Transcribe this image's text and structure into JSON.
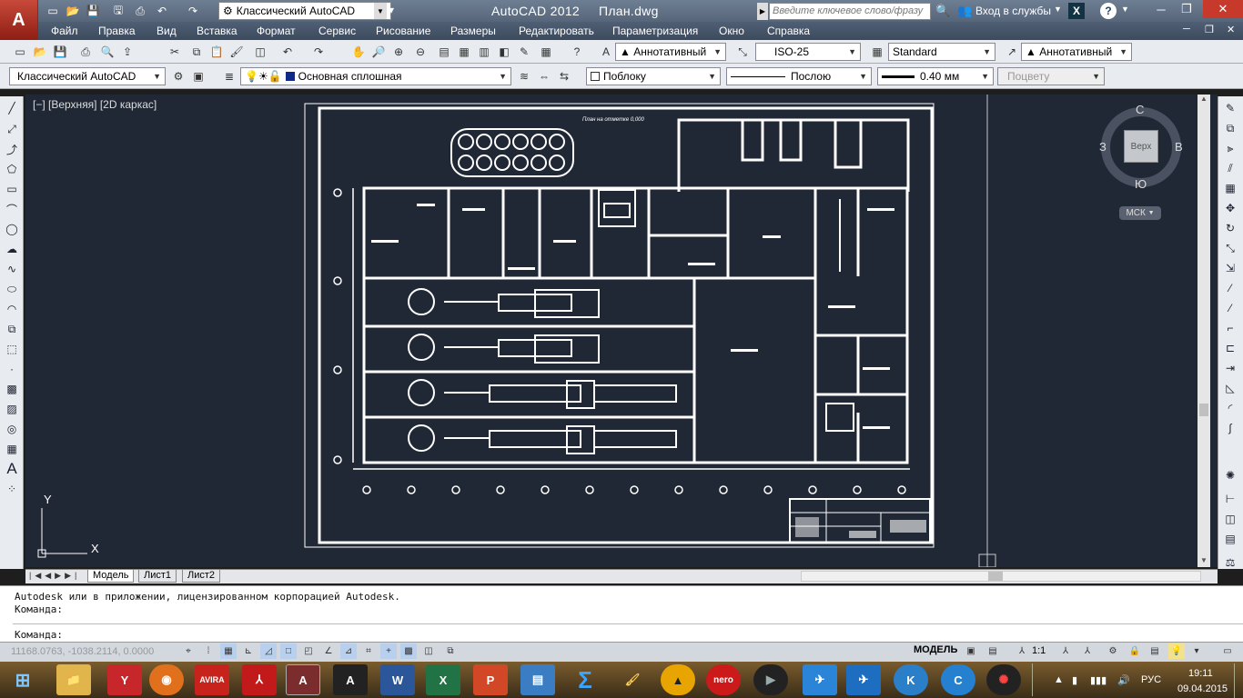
{
  "app": {
    "title": "AutoCAD 2012",
    "document": "План.dwg",
    "logo": "A"
  },
  "quick_access": {
    "workspace": "Классический AutoCAD",
    "icons": [
      "new-icon",
      "open-icon",
      "save-icon",
      "saveas-icon",
      "print-icon",
      "undo-icon",
      "redo-icon"
    ]
  },
  "search": {
    "placeholder": "Введите ключевое слово/фразу"
  },
  "signin": {
    "label": "Вход в службы"
  },
  "menu": [
    "Файл",
    "Правка",
    "Вид",
    "Вставка",
    "Формат",
    "Сервис",
    "Рисование",
    "Размеры",
    "Редактировать",
    "Параметризация",
    "Окно",
    "Справка"
  ],
  "toolbar2": {
    "annot_scale": "Аннотативный",
    "dim_style": "ISO-25",
    "table_style": "Standard",
    "mleader_style": "Аннотативный"
  },
  "toolbar3": {
    "workspace": "Классический AutoCAD",
    "layer": "Основная сплошная",
    "color": "Поблоку",
    "linetype": "Послою",
    "lineweight": "0.40 мм",
    "plotstyle": "Поцвету"
  },
  "viewport": {
    "label": "[−] [Верхняя] [2D каркас]",
    "viewcube": {
      "top": "С",
      "bottom": "Ю",
      "left": "З",
      "right": "В",
      "face": "Верх"
    },
    "ucs": "МСК",
    "axis_x": "X",
    "axis_y": "Y"
  },
  "drawing": {
    "header": "План на отметке 0,000"
  },
  "tabs": [
    "Модель",
    "Лист1",
    "Лист2"
  ],
  "command": {
    "line1": "Autodesk или в приложении, лицензированном корпорацией Autodesk.",
    "line2": "Команда:",
    "prompt": "Команда:"
  },
  "status": {
    "coords": "11168.0763, -1038.2114, 0.0000",
    "mode": "МОДЕЛЬ",
    "scale": "1:1"
  },
  "taskbar": {
    "apps": [
      "windows-start",
      "file-explorer",
      "yandex-browser",
      "firefox",
      "avira",
      "acrobat",
      "autocad-2012",
      "autocad",
      "word",
      "excel",
      "powerpoint",
      "remote-desktop",
      "sigma",
      "paint",
      "archicad",
      "nero",
      "media-player",
      "airplane-app",
      "plane-app",
      "k-app",
      "c-app",
      "burn-app"
    ],
    "lang": "РУС",
    "time": "19:11",
    "date": "09.04.2015"
  },
  "colors": {
    "canvas_bg": "#212835",
    "drawing_stroke": "#ffffff",
    "titlebar": "#5f6e83",
    "app_red": "#b33a2c"
  }
}
